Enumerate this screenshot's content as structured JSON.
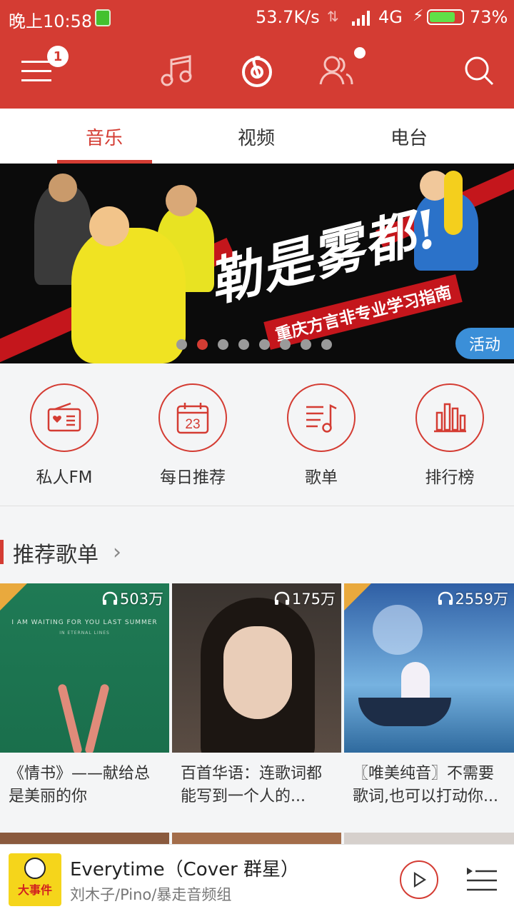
{
  "status_bar": {
    "time": "晚上10:58",
    "speed": "53.7K/s",
    "network": "4G",
    "battery_pct": "73%",
    "battery_level": 0.73
  },
  "header": {
    "menu_badge": "1",
    "icons": [
      "menu-icon",
      "music-note-icon",
      "netease-logo-icon",
      "friends-icon",
      "search-icon"
    ]
  },
  "tabs": [
    {
      "label": "音乐",
      "active": true
    },
    {
      "label": "视频",
      "active": false
    },
    {
      "label": "电台",
      "active": false
    }
  ],
  "banner": {
    "headline": "勒是雾都!",
    "subline": "重庆方言非专业学习指南",
    "tag": "活动",
    "page_count": 8,
    "active_index": 1
  },
  "entries": [
    {
      "label": "私人FM",
      "icon": "radio-icon"
    },
    {
      "label": "每日推荐",
      "icon": "calendar-icon",
      "day": "23"
    },
    {
      "label": "歌单",
      "icon": "playlist-icon"
    },
    {
      "label": "排行榜",
      "icon": "chart-icon"
    }
  ],
  "section": {
    "title": "推荐歌单"
  },
  "playlists": [
    {
      "count": "503万",
      "name": "《情书》——献给总是美丽的你",
      "cover_line1": "I AM WAITING FOR YOU LAST SUMMER",
      "cover_line2": "IN ETERNAL LINES"
    },
    {
      "count": "175万",
      "name": "百首华语：连歌词都能写到一个人的..."
    },
    {
      "count": "2559万",
      "name": "〖唯美纯音〗不需要歌词,也可以打动你..."
    }
  ],
  "player": {
    "art_label": "大事件",
    "song": "Everytime（Cover 群星）",
    "artist": "刘木子/Pino/暴走音频组"
  },
  "colors": {
    "brand": "#d43c33",
    "badge_corner": "#e9a93d",
    "tag_blue": "#3b8fd8"
  }
}
